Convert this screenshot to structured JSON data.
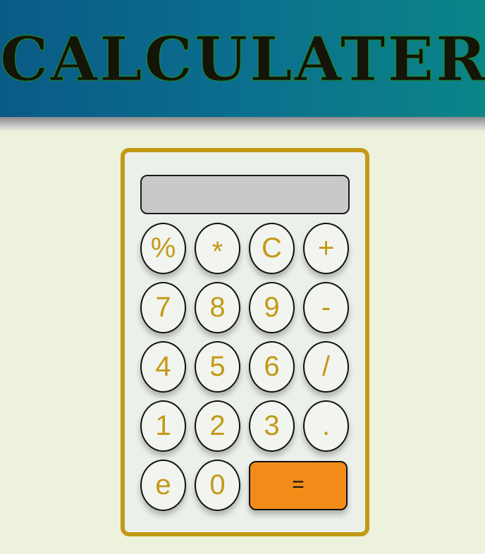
{
  "header": {
    "title": "CALCULATER"
  },
  "calculator": {
    "display_value": "",
    "keys": [
      [
        "%",
        "*",
        "C",
        "+"
      ],
      [
        "7",
        "8",
        "9",
        "-"
      ],
      [
        "4",
        "5",
        "6",
        "/"
      ],
      [
        "1",
        "2",
        "3",
        "."
      ],
      [
        "e",
        "0",
        "="
      ]
    ]
  },
  "colors": {
    "header_gradient_start": "#0a5a86",
    "header_gradient_end": "#0b8588",
    "page_background": "#ecf2dc",
    "calculator_border": "#c39a16",
    "key_text": "#c39a16",
    "equals_background": "#f28c19",
    "display_background": "#c9c9c9"
  }
}
